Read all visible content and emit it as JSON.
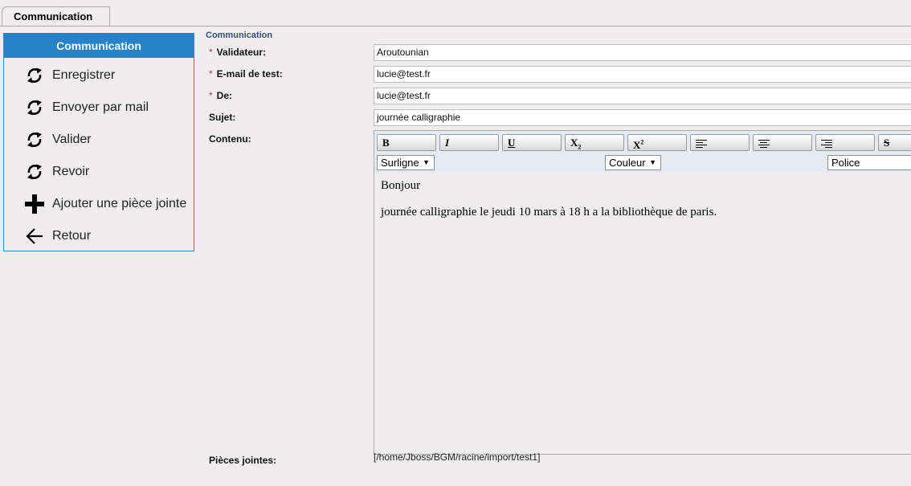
{
  "tab": {
    "label": "Communication"
  },
  "sidebar": {
    "title": "Communication",
    "items": [
      {
        "label": "Enregistrer",
        "icon": "refresh-icon"
      },
      {
        "label": "Envoyer par mail",
        "icon": "refresh-icon"
      },
      {
        "label": "Valider",
        "icon": "refresh-icon"
      },
      {
        "label": "Revoir",
        "icon": "refresh-icon"
      },
      {
        "label": "Ajouter une pièce jointe",
        "icon": "plus-icon"
      },
      {
        "label": "Retour",
        "icon": "arrow-left-icon"
      }
    ]
  },
  "form": {
    "section": "Communication",
    "required_mark": "*",
    "validateur": {
      "label": "Validateur:",
      "value": "Aroutounian"
    },
    "email_test": {
      "label": "E-mail de test:",
      "value": "lucie@test.fr"
    },
    "de": {
      "label": "De:",
      "value": "lucie@test.fr"
    },
    "sujet": {
      "label": "Sujet:",
      "value": "journée calligraphie"
    },
    "contenu": {
      "label": "Contenu:"
    },
    "pieces": {
      "label": "Pièces jointes:",
      "value": "[/home/Jboss/BGM/racine/import/test1]"
    }
  },
  "editor": {
    "buttons": {
      "bold": "B",
      "italic": "I",
      "underline": "U",
      "subscript": "X",
      "subscript_sub": "2",
      "superscript": "X",
      "superscript_sup": "2",
      "strike": "S"
    },
    "selects": {
      "highlight": "Surligne",
      "color": "Couleur",
      "font": "Police"
    },
    "content": {
      "line1": "Bonjour",
      "line2": "journée calligraphie le jeudi 10 mars à 18 h a la bibliothèque de paris."
    }
  },
  "colors": {
    "accent": "#2683c6",
    "required": "#c0392b"
  }
}
